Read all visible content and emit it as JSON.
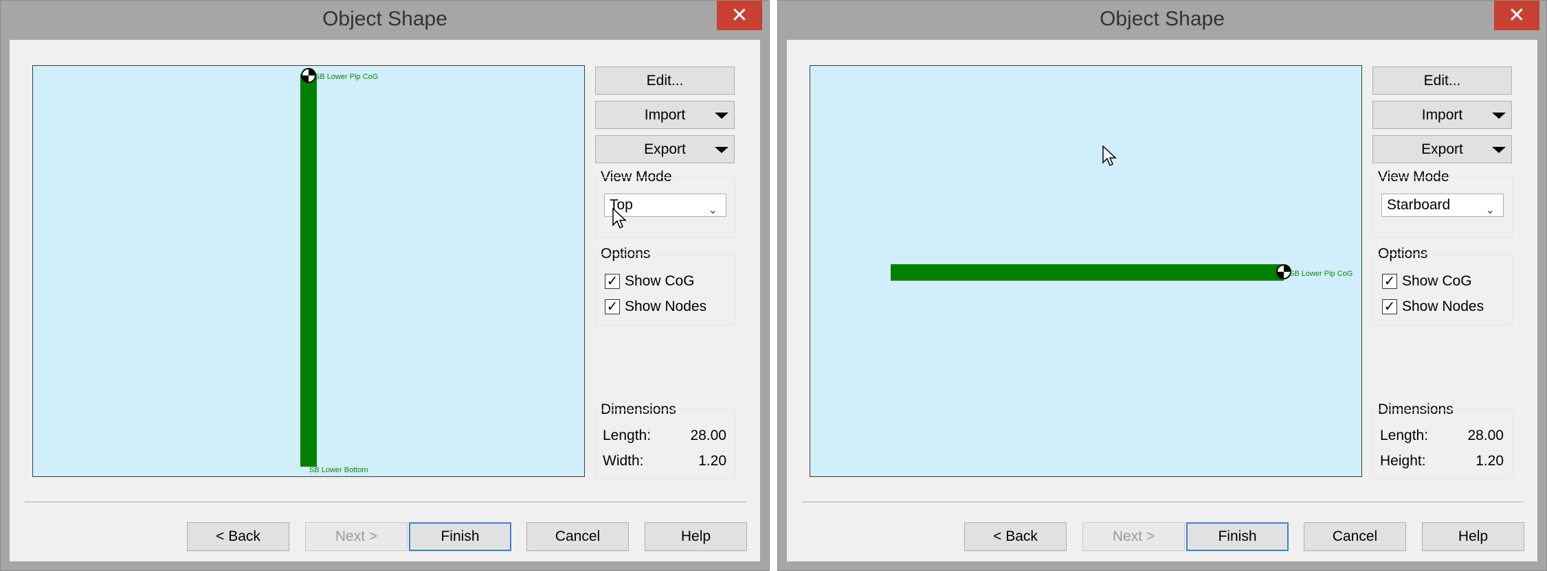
{
  "dialogs": [
    {
      "title": "Object Shape",
      "close_glyph": "✕",
      "buttons": {
        "edit": "Edit...",
        "import": "Import",
        "export": "Export",
        "back": "< Back",
        "next": "Next >",
        "finish": "Finish",
        "cancel": "Cancel",
        "help": "Help"
      },
      "view_mode": {
        "label": "View Mode",
        "value": "Top"
      },
      "options": {
        "label": "Options",
        "show_cog": "Show CoG",
        "show_nodes": "Show Nodes"
      },
      "dimensions": {
        "label": "Dimensions",
        "row1_label": "Length:",
        "row1_value": "28.00",
        "row2_label": "Width:",
        "row2_value": "1.20"
      },
      "preview": {
        "cog_label": "SB Lower Pip CoG",
        "bottom_label": "SB Lower Bottom"
      }
    },
    {
      "title": "Object Shape",
      "close_glyph": "✕",
      "buttons": {
        "edit": "Edit...",
        "import": "Import",
        "export": "Export",
        "back": "< Back",
        "next": "Next >",
        "finish": "Finish",
        "cancel": "Cancel",
        "help": "Help"
      },
      "view_mode": {
        "label": "View Mode",
        "value": "Starboard"
      },
      "options": {
        "label": "Options",
        "show_cog": "Show CoG",
        "show_nodes": "Show Nodes"
      },
      "dimensions": {
        "label": "Dimensions",
        "row1_label": "Length:",
        "row1_value": "28.00",
        "row2_label": "Height:",
        "row2_value": "1.20"
      },
      "preview": {
        "cog_label": "SB Lower Pip CoG"
      }
    }
  ],
  "colors": {
    "canvas_bg": "#d1eefb",
    "shape_fill": "#008000",
    "close_button": "#c84031",
    "default_button_border": "#3c7fd2"
  },
  "icons": [
    "close-icon",
    "dropdown-arrow-icon",
    "chevron-down-icon",
    "checkmark-icon",
    "cog-marker-icon",
    "mouse-cursor-icon"
  ]
}
